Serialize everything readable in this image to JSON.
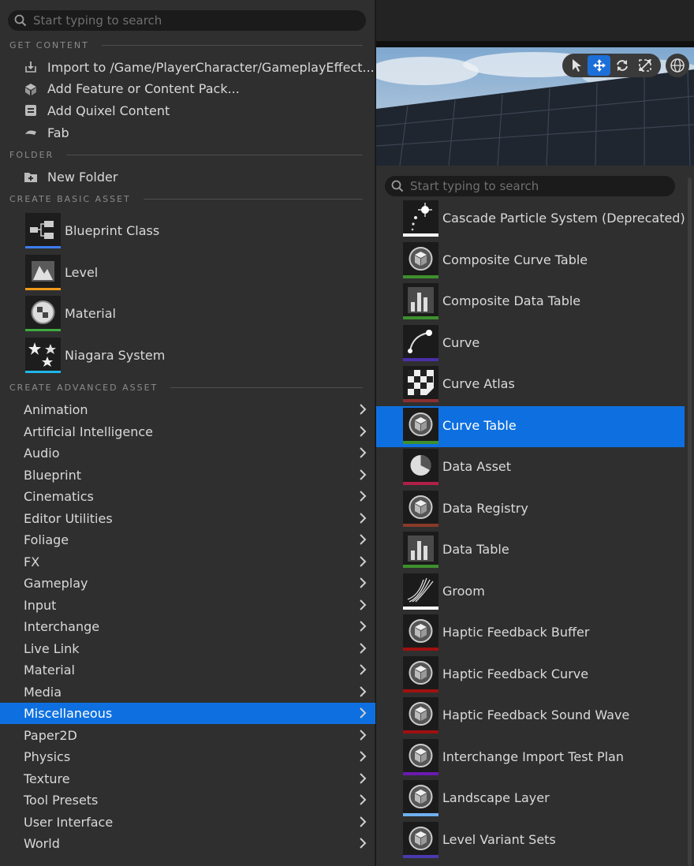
{
  "left_menu": {
    "search_placeholder": "Start typing to search",
    "sections": {
      "get_content": "GET CONTENT",
      "folder": "FOLDER",
      "basic": "CREATE BASIC ASSET",
      "advanced": "CREATE ADVANCED ASSET"
    },
    "get_content_items": [
      {
        "label": "Import to /Game/PlayerCharacter/GameplayEffect...",
        "icon": "import-icon"
      },
      {
        "label": "Add Feature or Content Pack...",
        "icon": "content-pack-icon"
      },
      {
        "label": "Add Quixel Content",
        "icon": "quixel-icon"
      },
      {
        "label": "Fab",
        "icon": "fab-icon"
      }
    ],
    "folder_items": [
      {
        "label": "New Folder",
        "icon": "new-folder-icon"
      }
    ],
    "basic_assets": [
      {
        "label": "Blueprint Class",
        "icon": "blueprint-class-icon",
        "color": "#3d7cf0"
      },
      {
        "label": "Level",
        "icon": "level-icon",
        "color": "#f09a1a"
      },
      {
        "label": "Material",
        "icon": "material-icon",
        "color": "#3eaa3e"
      },
      {
        "label": "Niagara System",
        "icon": "niagara-icon",
        "color": "#1fb6e8"
      }
    ],
    "categories": [
      "Animation",
      "Artificial Intelligence",
      "Audio",
      "Blueprint",
      "Cinematics",
      "Editor Utilities",
      "Foliage",
      "FX",
      "Gameplay",
      "Input",
      "Interchange",
      "Live Link",
      "Material",
      "Media",
      "Miscellaneous",
      "Paper2D",
      "Physics",
      "Texture",
      "Tool Presets",
      "User Interface",
      "World"
    ],
    "selected_category": "Miscellaneous"
  },
  "right_menu": {
    "search_placeholder": "Start typing to search",
    "assets": [
      {
        "label": "Cascade Particle System (Deprecated)",
        "icon": "particle-icon",
        "color": "#ffffff"
      },
      {
        "label": "Composite Curve Table",
        "icon": "cube-icon",
        "color": "#3e8f2e"
      },
      {
        "label": "Composite Data Table",
        "icon": "bar-chart-icon",
        "color": "#3e8f2e"
      },
      {
        "label": "Curve",
        "icon": "curve-icon",
        "color": "#4a2fa8"
      },
      {
        "label": "Curve Atlas",
        "icon": "checker-icon",
        "color": "#8a3030"
      },
      {
        "label": "Curve Table",
        "icon": "cube-icon",
        "color": "#3e8f2e"
      },
      {
        "label": "Data Asset",
        "icon": "pie-icon",
        "color": "#b02048"
      },
      {
        "label": "Data Registry",
        "icon": "cube-icon",
        "color": "#8a3a2a"
      },
      {
        "label": "Data Table",
        "icon": "bar-chart-icon",
        "color": "#3e8f2e"
      },
      {
        "label": "Groom",
        "icon": "groom-icon",
        "color": "#ffffff"
      },
      {
        "label": "Haptic Feedback Buffer",
        "icon": "cube-icon",
        "color": "#a01010"
      },
      {
        "label": "Haptic Feedback Curve",
        "icon": "cube-icon",
        "color": "#a01010"
      },
      {
        "label": "Haptic Feedback Sound Wave",
        "icon": "cube-icon",
        "color": "#a01010"
      },
      {
        "label": "Interchange Import Test Plan",
        "icon": "cube-icon",
        "color": "#6a1ab0"
      },
      {
        "label": "Landscape Layer",
        "icon": "cube-icon",
        "color": "#6fb0f0"
      },
      {
        "label": "Level Variant Sets",
        "icon": "cube-icon",
        "color": "#4a3ab0"
      }
    ],
    "selected_asset": "Curve Table"
  },
  "viewport_toolbar": {
    "tools": [
      "select-icon",
      "move-icon",
      "rotate-icon",
      "scale-icon"
    ],
    "active_tool": "move-icon",
    "world_icon": "globe-icon"
  },
  "colors": {
    "selection": "#0e70e0",
    "menu_bg": "#2f2f2f"
  }
}
